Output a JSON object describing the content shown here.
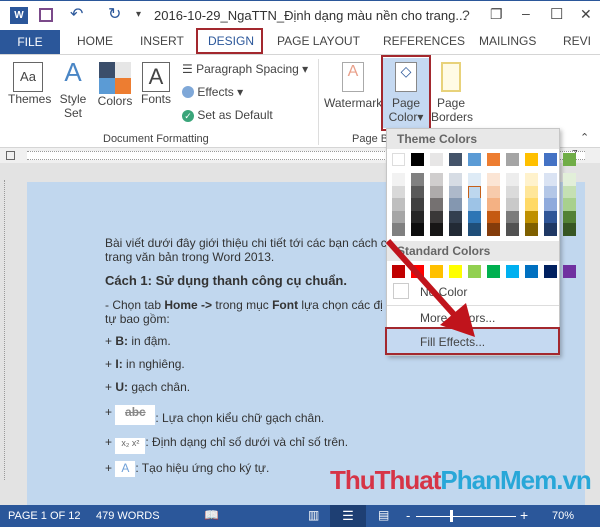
{
  "window": {
    "title": "2016-10-29_NgaTTN_Định dạng màu nền cho trang...",
    "help": "?",
    "restore": "❐",
    "minimize": "–",
    "maximize": "☐",
    "close": "✕"
  },
  "tabs": [
    "FILE",
    "HOME",
    "INSERT",
    "DESIGN",
    "PAGE LAYOUT",
    "REFERENCES",
    "MAILINGS",
    "REVI"
  ],
  "ribbon": {
    "themes": "Themes",
    "style_set": [
      "Style",
      "Set"
    ],
    "colors": "Colors",
    "fonts": "Fonts",
    "paragraph_spacing": "Paragraph Spacing",
    "effects": "Effects",
    "set_default": "Set as Default",
    "group_doc_formatting": "Document Formatting",
    "watermark": "Watermark",
    "page_color": [
      "Page",
      "Color"
    ],
    "page_borders": [
      "Page",
      "Borders"
    ],
    "group_page_bg": "Page B"
  },
  "ruler": {
    "end_mark": "7"
  },
  "page_color_menu": {
    "theme_header": "Theme Colors",
    "theme_colors": [
      "#ffffff",
      "#000000",
      "#e7e6e6",
      "#44546a",
      "#5b9bd5",
      "#ed7d31",
      "#a5a5a5",
      "#ffc000",
      "#4472c4",
      "#70ad47"
    ],
    "shades": [
      [
        "#f2f2f2",
        "#d9d9d9",
        "#bfbfbf",
        "#a6a6a6",
        "#808080"
      ],
      [
        "#808080",
        "#595959",
        "#404040",
        "#262626",
        "#0d0d0d"
      ],
      [
        "#d0cece",
        "#aeabab",
        "#757171",
        "#3a3838",
        "#171616"
      ],
      [
        "#d6dce4",
        "#adb9ca",
        "#8497b0",
        "#333f4f",
        "#222a35"
      ],
      [
        "#deebf6",
        "#bdd7ee",
        "#9dc3e6",
        "#2e75b5",
        "#1f4e79"
      ],
      [
        "#fbe5d5",
        "#f7cbac",
        "#f4b183",
        "#c55a11",
        "#843c0b"
      ],
      [
        "#ededed",
        "#dbdbdb",
        "#c9c9c9",
        "#7b7b7b",
        "#525252"
      ],
      [
        "#fff2cc",
        "#ffe699",
        "#ffd966",
        "#bf9000",
        "#7f6000"
      ],
      [
        "#dae3f3",
        "#b4c7e7",
        "#8faadc",
        "#2f5597",
        "#1f3864"
      ],
      [
        "#e2efd9",
        "#c5e0b3",
        "#a8d08d",
        "#538135",
        "#375623"
      ]
    ],
    "selected": "#bdd7ee",
    "standard_header": "Standard Colors",
    "standard_colors": [
      "#c00000",
      "#ff0000",
      "#ffc000",
      "#ffff00",
      "#92d050",
      "#00b050",
      "#00b0f0",
      "#0070c0",
      "#002060",
      "#7030a0"
    ],
    "no_color": "No Color",
    "more_colors": "More Colors...",
    "fill_effects": "Fill Effects..."
  },
  "document": {
    "intro1": "Bài viết dưới đây giới thiệu chi tiết tới các bạn cách c",
    "intro2": "trang văn bản trong Word 2013.",
    "heading": "Cách 1: Sử dụng thanh công cụ chuẩn.",
    "l1a": "- Chọn tab ",
    "l1b": "Home ->",
    "l1c": " trong mục ",
    "l1d": "Font",
    "l1e": " lựa chọn các đị",
    "l2": "tự bao gồm:",
    "b_key": "B:",
    "b_text": " in đậm.",
    "i_key": "I:",
    "i_text": " in nghiêng.",
    "u_key": "U:",
    "u_text": " gạch chân.",
    "plus": "+",
    "strike_icon_text": "abc",
    "strike_text": ": Lựa chọn kiểu chữ gạch chân.",
    "sub_icon_text": "x₂ x²",
    "sub_text": ": Định dạng chỉ số dưới và chỉ số trên.",
    "effect_icon_text": "A",
    "effect_text": ": Tạo hiệu ứng cho ký tự."
  },
  "watermark": {
    "part1": "ThuThuat",
    "part2": "PhanMem.vn"
  },
  "status": {
    "page": "PAGE 1 OF 12",
    "words": "479 WORDS",
    "zoom": "70%",
    "zoom_percent": 70
  },
  "colors": {
    "accent": "#2b579a",
    "highlight": "#a3282e",
    "page_bg": "#c1d7ee"
  }
}
